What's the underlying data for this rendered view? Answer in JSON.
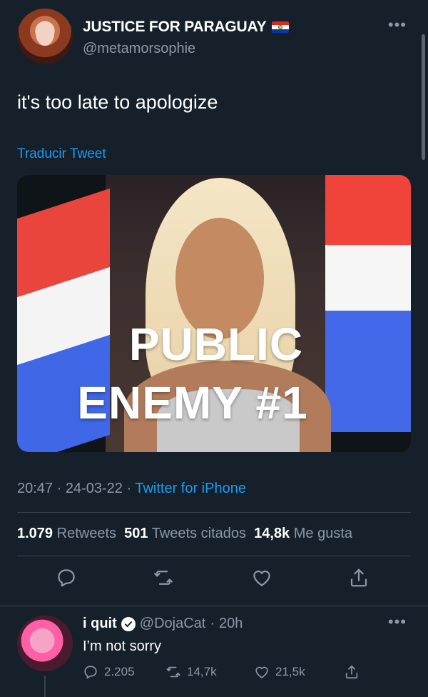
{
  "tweet": {
    "display_name": "JUSTICE FOR PARAGUAY",
    "name_emoji": "paraguay-flag-icon",
    "handle": "@metamorsophie",
    "text": "it's too late to apologize",
    "translate": "Traducir Tweet",
    "media": {
      "overlay_line1": "PUBLIC",
      "overlay_line2": "ENEMY #1"
    },
    "time": "20:47",
    "date": "24-03-22",
    "source": "Twitter for iPhone",
    "stats": {
      "retweets_count": "1.079",
      "retweets_label": "Retweets",
      "quotes_count": "501",
      "quotes_label": "Tweets citados",
      "likes_count": "14,8k",
      "likes_label": "Me gusta"
    },
    "actions": [
      "reply-icon",
      "retweet-icon",
      "like-icon",
      "share-icon"
    ]
  },
  "reply": {
    "name": "i quit",
    "handle": "@DojaCat",
    "time": "20h",
    "text": "I’m not sorry",
    "reply_count": "2.205",
    "retweet_count": "14,7k",
    "like_count": "21,5k"
  },
  "colors": {
    "background": "#15202b",
    "accent": "#1d9bf0",
    "secondary_text": "#8b98a5",
    "divider": "#38444d"
  }
}
